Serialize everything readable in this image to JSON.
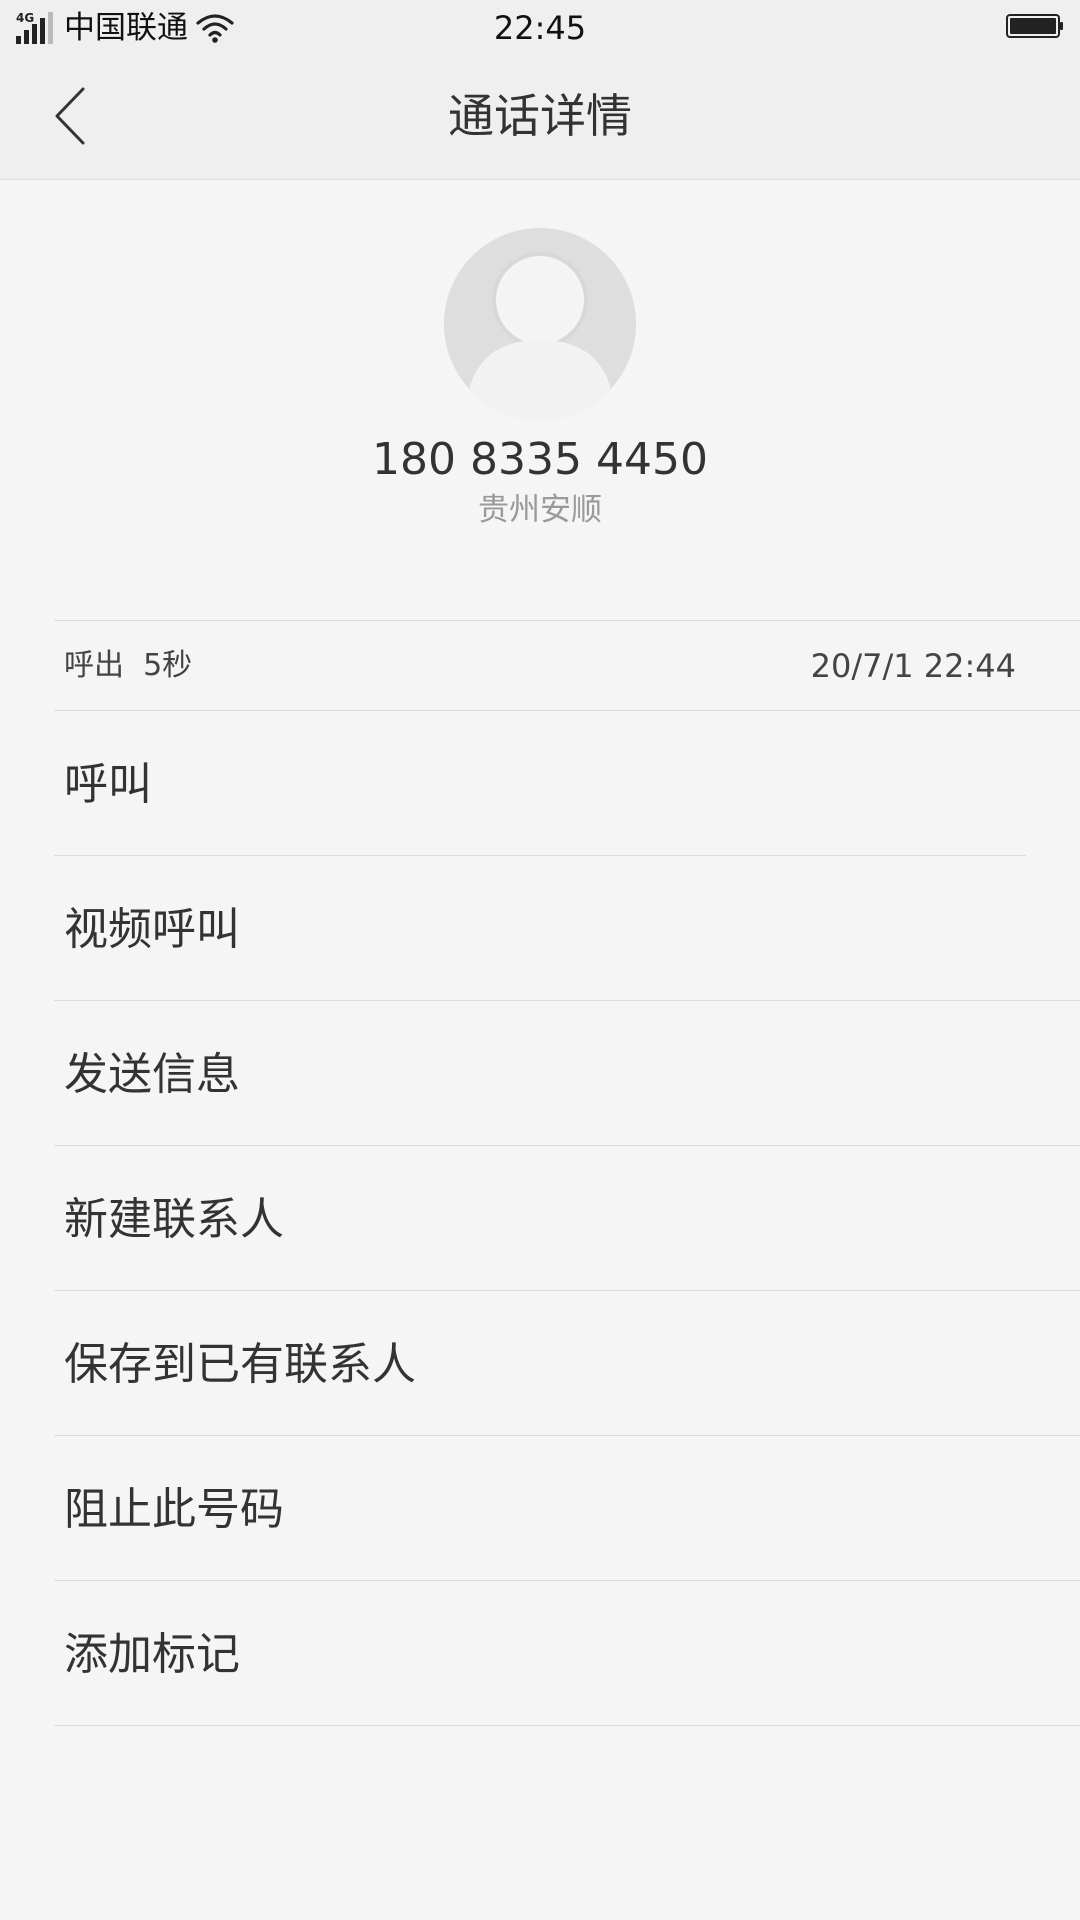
{
  "status_bar": {
    "network": "4G",
    "carrier": "中国联通",
    "time": "22:45"
  },
  "nav": {
    "title": "通话详情"
  },
  "contact": {
    "number": "180 8335 4450",
    "location": "贵州安顺"
  },
  "call_record": {
    "type": "呼出  5秒",
    "datetime": "20/7/1 22:44"
  },
  "actions": [
    {
      "label": "呼叫"
    },
    {
      "label": "视频呼叫"
    },
    {
      "label": "发送信息"
    },
    {
      "label": "新建联系人"
    },
    {
      "label": "保存到已有联系人"
    },
    {
      "label": "阻止此号码"
    },
    {
      "label": "添加标记"
    }
  ],
  "colors": {
    "background": "#f5f5f5",
    "bar_background": "#efefef",
    "text_primary": "#333333",
    "text_secondary": "#999999",
    "divider": "#dedede"
  }
}
